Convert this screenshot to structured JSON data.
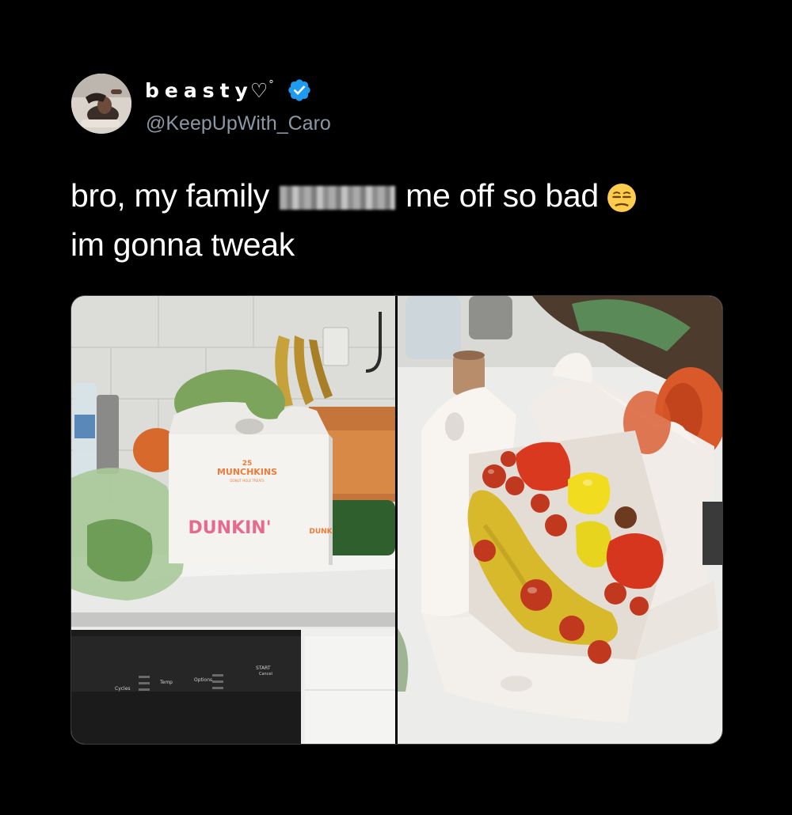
{
  "tweet": {
    "display_name": "beasty",
    "name_symbol": "♡",
    "name_degree": "°",
    "handle": "@KeepUpWith_Caro",
    "text_line1_part1": "bro, my family",
    "text_line1_part2": "me off so bad",
    "text_line2": "im gonna tweak",
    "emoji": "unamused-face-icon"
  },
  "media": {
    "left_photo": {
      "box_number": "25",
      "box_title": "MUNCHKINS",
      "box_subtitle": "DONUT HOLE TREATS",
      "box_brand": "DUNKIN'",
      "box_side_brand": "DUNK",
      "dishwasher_labels": [
        "Cycles",
        "Temp",
        "Options",
        "START",
        "Cancel"
      ]
    }
  },
  "colors": {
    "background": "#000000",
    "text": "#ffffff",
    "secondary_text": "#8b98a5",
    "verified_badge": "#1d9bf0",
    "dunkin_pink": "#e66a8e",
    "dunkin_orange": "#ee7b3a"
  }
}
